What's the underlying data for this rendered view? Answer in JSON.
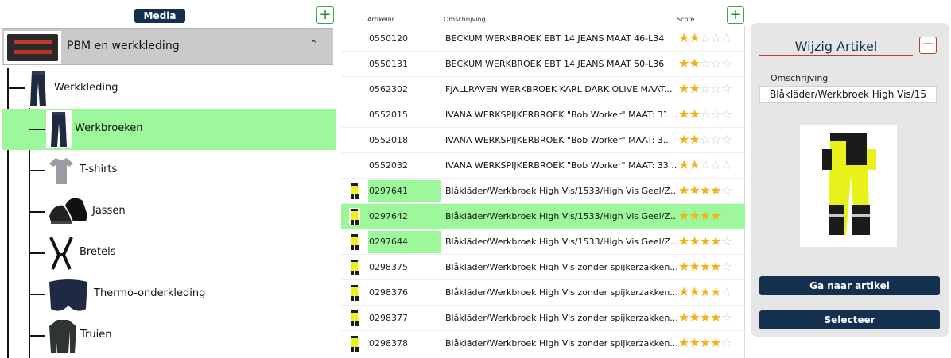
{
  "tree": {
    "media_label": "Media",
    "add_label": "+",
    "root": {
      "label": "PBM en werkkleding",
      "chevron": "^"
    },
    "nodes": [
      {
        "label": "Werkkleding",
        "thumb": "trousers-navy"
      },
      {
        "label": "Werkbroeken",
        "thumb": "trousers-navy",
        "active": true
      },
      {
        "label": "T-shirts",
        "thumb": "tshirt-grey"
      },
      {
        "label": "Jassen",
        "thumb": "shoes-black"
      },
      {
        "label": "Bretels",
        "thumb": "suspenders-black"
      },
      {
        "label": "Thermo-onderkleding",
        "thumb": "thermo-navy"
      },
      {
        "label": "Truien",
        "thumb": "sweater-dark"
      }
    ]
  },
  "table": {
    "add_label": "+",
    "headers": {
      "art": "Artikelnr",
      "desc": "Omschrijving",
      "score": "Score"
    },
    "rows": [
      {
        "art": "0550120",
        "desc": "BECKUM WERKBROEK EBT 14 JEANS MAAT 46-L34",
        "stars": 2,
        "thumb": false,
        "art_hl": false,
        "sel": false
      },
      {
        "art": "0550131",
        "desc": "BECKUM WERKBROEK EBT 14 JEANS MAAT 50-L36",
        "stars": 2,
        "thumb": false,
        "art_hl": false,
        "sel": false
      },
      {
        "art": "0562302",
        "desc": "FJALLRAVEN WERKBROEK KARL DARK OLIVE MAAT...",
        "stars": 2,
        "thumb": false,
        "art_hl": false,
        "sel": false
      },
      {
        "art": "0552015",
        "desc": "IVANA WERKSPIJKERBROEK \"Bob Worker\" MAAT: 31...",
        "stars": 2,
        "thumb": false,
        "art_hl": false,
        "sel": false
      },
      {
        "art": "0552018",
        "desc": "IVANA WERKSPIJKERBROEK \"Bob Worker\" MAAT: 3...",
        "stars": 2,
        "thumb": false,
        "art_hl": false,
        "sel": false
      },
      {
        "art": "0552032",
        "desc": "IVANA WERKSPIJKERBROEK \"Bob Worker\" MAAT: 33...",
        "stars": 2,
        "thumb": false,
        "art_hl": false,
        "sel": false
      },
      {
        "art": "0297641",
        "desc": "Blåkläder/Werkbroek High Vis/1533/High Vis Geel/Z...",
        "stars": 4,
        "thumb": true,
        "art_hl": true,
        "sel": false
      },
      {
        "art": "0297642",
        "desc": "Blåkläder/Werkbroek High Vis/1533/High Vis Geel/Z...",
        "stars": 4,
        "thumb": true,
        "art_hl": false,
        "sel": true
      },
      {
        "art": "0297644",
        "desc": "Blåkläder/Werkbroek High Vis/1533/High Vis Geel/Z...",
        "stars": 4,
        "thumb": true,
        "art_hl": true,
        "sel": false
      },
      {
        "art": "0298375",
        "desc": "Blåkläder/Werkbroek High Vis zonder spijkerzakken...",
        "stars": 4,
        "thumb": true,
        "art_hl": false,
        "sel": false
      },
      {
        "art": "0298376",
        "desc": "Blåkläder/Werkbroek High Vis zonder spijkerzakken...",
        "stars": 4,
        "thumb": true,
        "art_hl": false,
        "sel": false
      },
      {
        "art": "0298377",
        "desc": "Blåkläder/Werkbroek High Vis zonder spijkerzakken...",
        "stars": 4,
        "thumb": true,
        "art_hl": false,
        "sel": false
      },
      {
        "art": "0298378",
        "desc": "Blåkläder/Werkbroek High Vis zonder spijkerzakken...",
        "stars": 4,
        "thumb": true,
        "art_hl": false,
        "sel": false
      }
    ],
    "max_stars": 5
  },
  "detail": {
    "title": "Wijzig Artikel",
    "collapse_label": "−",
    "field_label": "Omschrijving",
    "field_value": "Blåkläder/Werkbroek High Vis/15",
    "goto_label": "Ga naar artikel",
    "select_label": "Selecteer"
  },
  "colors": {
    "navy": "#15304f",
    "selection_green": "#9cf89a",
    "accent_red": "#c0392b",
    "star_gold": "#f2b31a",
    "add_green": "#3aa64a"
  }
}
